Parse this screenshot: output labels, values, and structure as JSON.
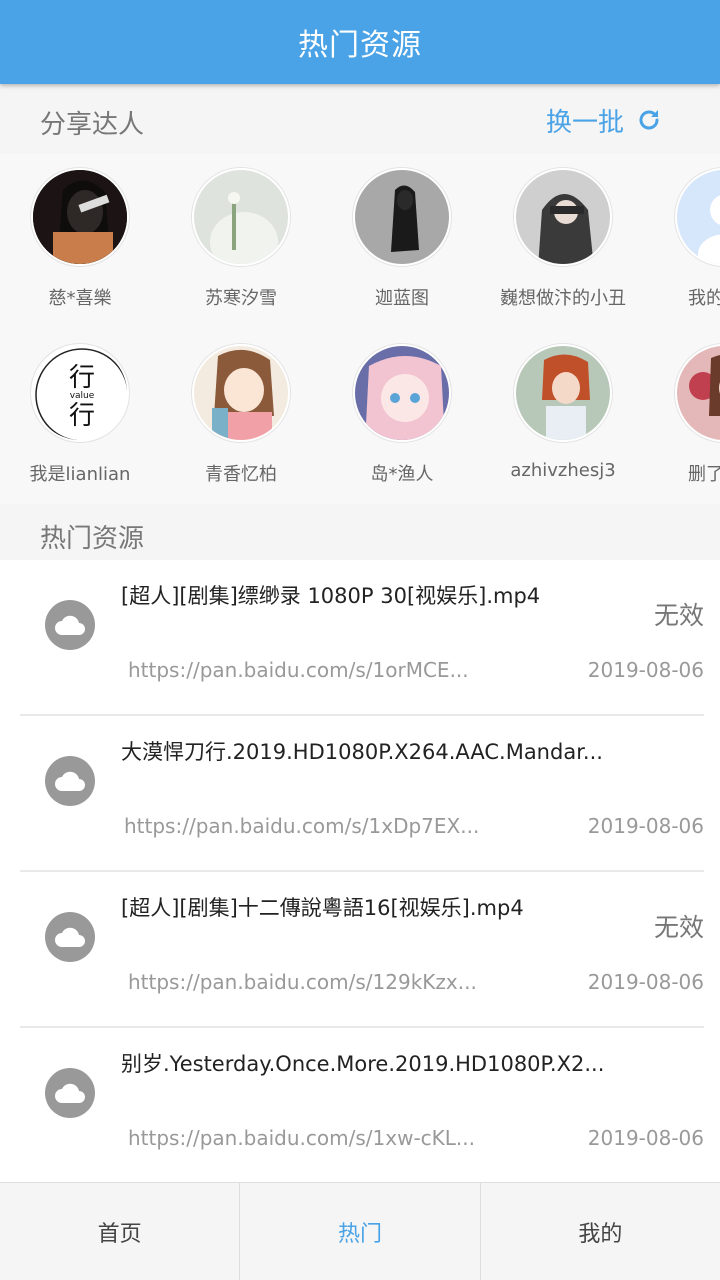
{
  "appbar": {
    "title": "热门资源"
  },
  "share": {
    "title": "分享达人",
    "refresh_label": "换一批",
    "users": [
      {
        "name": "慈*喜樂",
        "avatar": "photo-girl-microphone",
        "color": "#3a2a2a"
      },
      {
        "name": "苏寒汐雪",
        "avatar": "photo-girl-white",
        "color": "#d8dcd6"
      },
      {
        "name": "迦蓝图",
        "avatar": "photo-dark-hair",
        "color": "#8a8a8a"
      },
      {
        "name": "巍想做汴的小丑",
        "avatar": "photo-hooded",
        "color": "#5a5a5a"
      },
      {
        "name": "我的名字",
        "avatar": "default-avatar",
        "color": "#c8dcf8"
      },
      {
        "name": "我是lianlian",
        "avatar": "calligraphy-logo",
        "color": "#ffffff"
      },
      {
        "name": "青香忆柏",
        "avatar": "anime-girl-brown",
        "color": "#e8c8b0"
      },
      {
        "name": "岛*渔人",
        "avatar": "anime-girl-pink",
        "color": "#e8b8c8"
      },
      {
        "name": "azhivzhesj3",
        "avatar": "photo-girl-red-hair",
        "color": "#c89078"
      },
      {
        "name": "删了我们",
        "avatar": "photo-girl-flowers",
        "color": "#d8a0a0"
      }
    ]
  },
  "hot": {
    "title": "热门资源",
    "items": [
      {
        "title": "[超人][剧集]缥缈录 1080P 30[视娱乐].mp4",
        "status": "无效",
        "url": "https://pan.baidu.com/s/1orMCE...",
        "date": "2019-08-06"
      },
      {
        "title": "大漠悍刀行.2019.HD1080P.X264.AAC.Mandar...",
        "status": "",
        "url": "https://pan.baidu.com/s/1xDp7EX...",
        "date": "2019-08-06"
      },
      {
        "title": "[超人][剧集]十二傳說粵語16[视娱乐].mp4",
        "status": "无效",
        "url": "https://pan.baidu.com/s/129kKzx...",
        "date": "2019-08-06"
      },
      {
        "title": "别岁.Yesterday.Once.More.2019.HD1080P.X2...",
        "status": "",
        "url": "https://pan.baidu.com/s/1xw-cKL...",
        "date": "2019-08-06"
      }
    ]
  },
  "tabs": {
    "home": "首页",
    "hot": "热门",
    "mine": "我的"
  },
  "colors": {
    "accent": "#4aa3e6",
    "cloud_icon": "#999999"
  }
}
